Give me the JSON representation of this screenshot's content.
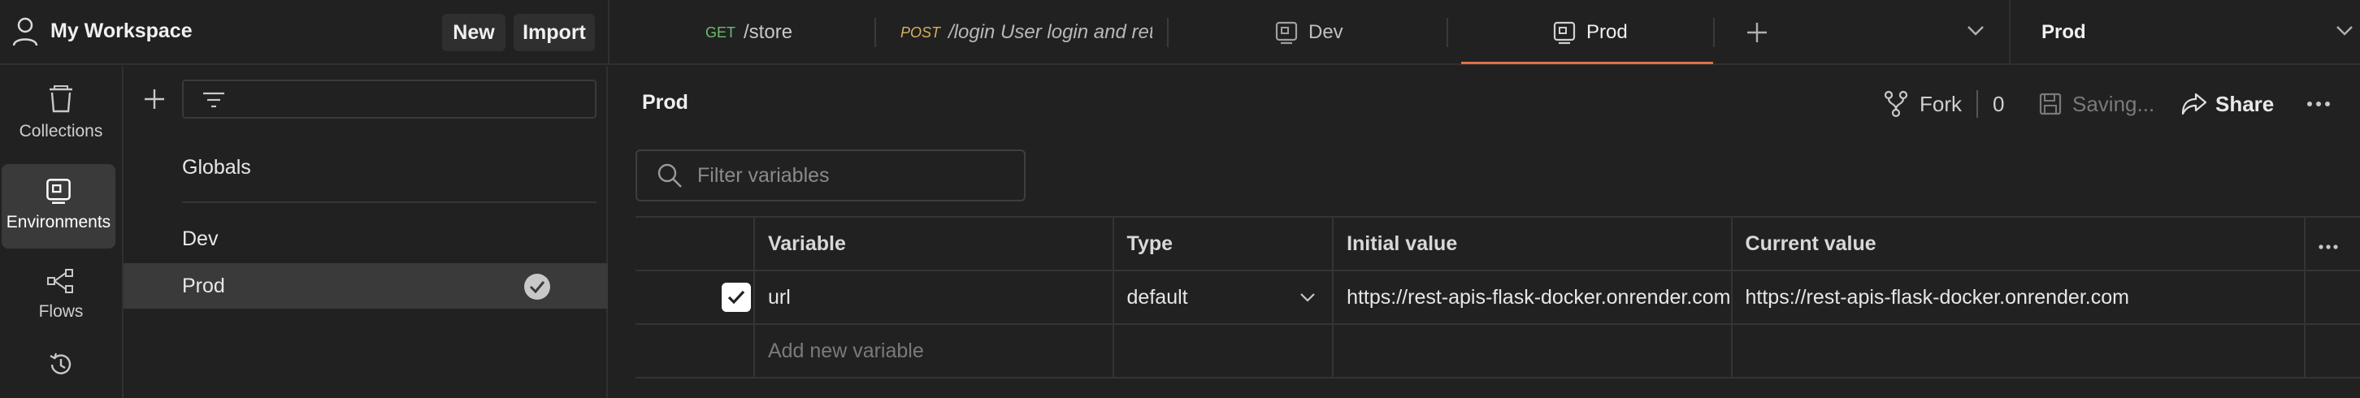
{
  "workspace": {
    "title": "My Workspace",
    "new_label": "New",
    "import_label": "Import"
  },
  "tabs": [
    {
      "method": "GET",
      "label": "/store"
    },
    {
      "method": "POST",
      "label": "/login User login and ret"
    },
    {
      "label": "Dev"
    },
    {
      "label": "Prod"
    }
  ],
  "env_selector": {
    "value": "Prod"
  },
  "leftnav": {
    "collections": "Collections",
    "environments": "Environments",
    "flows": "Flows"
  },
  "env_list": {
    "globals": "Globals",
    "dev": "Dev",
    "prod": "Prod"
  },
  "main": {
    "title": "Prod",
    "fork_label": "Fork",
    "fork_count": "0",
    "saving_label": "Saving...",
    "share_label": "Share",
    "filter_placeholder": "Filter variables"
  },
  "table": {
    "headers": {
      "variable": "Variable",
      "type": "Type",
      "initial": "Initial value",
      "current": "Current value"
    },
    "rows": [
      {
        "checked": true,
        "variable": "url",
        "type": "default",
        "initial": "https://rest-apis-flask-docker.onrender.com",
        "current": "https://rest-apis-flask-docker.onrender.com"
      }
    ],
    "add_placeholder": "Add new variable"
  },
  "colors": {
    "active_tab_underline": "#e0704a",
    "background": "#212121"
  },
  "icons": [
    "user-icon",
    "trash-icon",
    "environment-icon",
    "flows-icon",
    "history-icon",
    "plus-icon",
    "filter-icon",
    "check-circle-icon",
    "search-icon",
    "fork-icon",
    "save-icon",
    "share-icon",
    "more-icon",
    "chevron-down-icon"
  ]
}
